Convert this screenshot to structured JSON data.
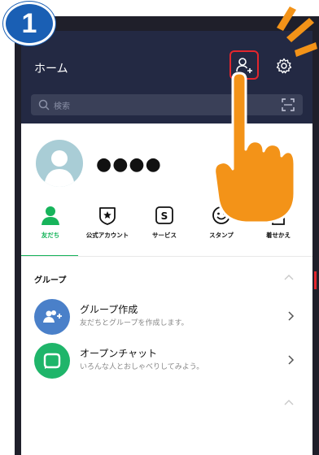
{
  "step_badge": "1",
  "header": {
    "title": "ホーム",
    "search_placeholder": "検索",
    "icons": {
      "add_friend": "add-friend-icon",
      "settings": "gear-icon",
      "search": "search-icon",
      "scan": "qr-scan-icon"
    }
  },
  "profile": {
    "name": "●●●●"
  },
  "tabs": [
    {
      "label": "友だち",
      "icon": "person-icon",
      "active": true
    },
    {
      "label": "公式アカウント",
      "icon": "official-account-icon",
      "active": false
    },
    {
      "label": "サービス",
      "icon": "service-icon",
      "active": false
    },
    {
      "label": "スタンプ",
      "icon": "sticker-icon",
      "active": false
    },
    {
      "label": "着せかえ",
      "icon": "theme-icon",
      "active": false
    }
  ],
  "group_section": {
    "title": "グループ",
    "rows": [
      {
        "title": "グループ作成",
        "subtitle": "友だちとグループを作成します。",
        "icon": "group-add-icon"
      },
      {
        "title": "オープンチャット",
        "subtitle": "いろんな人とおしゃべりしてみよう。",
        "icon": "openchat-icon"
      }
    ]
  },
  "colors": {
    "header_bg": "#232943",
    "active_green": "#17b45b",
    "highlight_red": "#e3262d",
    "hand_orange": "#f39318",
    "badge_blue": "#1a5fb4",
    "group_icon_bg": "#4a80c9",
    "openchat_icon_bg": "#1fb56a"
  }
}
